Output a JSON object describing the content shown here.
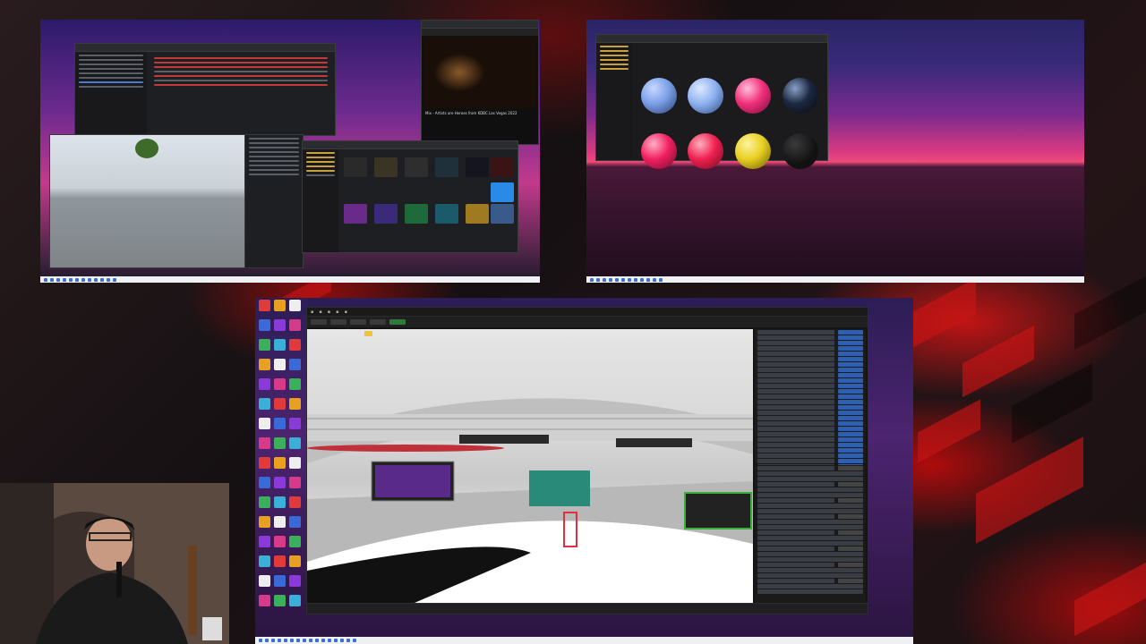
{
  "screen": {
    "accent": "#d21c1c",
    "taskbar_color": "#eef0f3"
  },
  "monitor_left": {
    "browser": {
      "video_title": "Mix - Artists are Heroes from KDBC Las Vegas 2022"
    }
  },
  "monitor_right": {
    "content": "material-browser-spheres",
    "sphere_colors": [
      "#7aa0e8",
      "#8fb2f0",
      "#f0307a",
      "#1c2840",
      "#f02060",
      "#f02050",
      "#e8d020"
    ]
  },
  "main_monitor": {
    "app": "unreal-editor",
    "desktop_icon_count": 48
  },
  "webcam": {
    "present": true
  }
}
